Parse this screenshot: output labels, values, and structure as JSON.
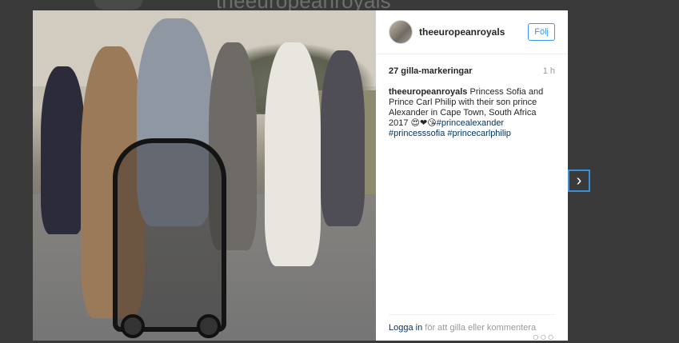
{
  "background": {
    "title": "theeuropeanroyals"
  },
  "post": {
    "username": "theeuropeanroyals",
    "follow_label": "Följ",
    "likes": "27 gilla-markeringar",
    "time_ago": "1 h",
    "caption_user": "theeuropeanroyals",
    "caption_text": "Princess Sofia and Prince Carl Philip with their son prince Alexander in Cape Town, South Africa 2017",
    "caption_emoji": "😍❤😘",
    "hashtags": [
      "#princealexander",
      "#princesssofia",
      "#princecarlphilip"
    ],
    "login_link": "Logga in",
    "login_suffix": "för att gilla eller kommentera",
    "more_label": "○○○"
  },
  "nav": {
    "next_icon": "›"
  },
  "colors": {
    "accent": "#3897f0",
    "link": "#003569",
    "nav_border": "#3b8ed8"
  }
}
